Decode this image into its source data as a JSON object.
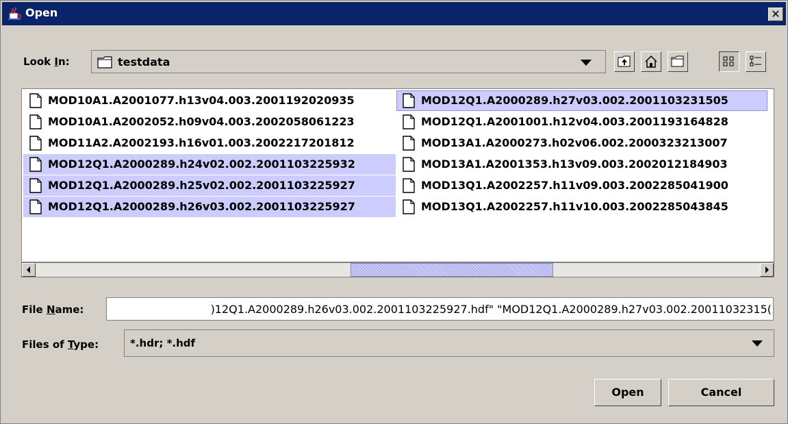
{
  "window": {
    "title": "Open",
    "close_label": "✕"
  },
  "look_in": {
    "label_pre": "Look ",
    "label_key": "I",
    "label_post": "n:",
    "value": "testdata"
  },
  "toolbar": {
    "icons": [
      "up-folder-icon",
      "home-icon",
      "new-folder-icon",
      "list-view-icon",
      "details-view-icon"
    ]
  },
  "files": [
    {
      "name": "MOD10A1.A2001077.h13v04.003.2001192020935",
      "selected": false
    },
    {
      "name": "MOD10A1.A2002052.h09v04.003.2002058061223",
      "selected": false
    },
    {
      "name": "MOD11A2.A2002193.h16v01.003.2002217201812",
      "selected": false
    },
    {
      "name": "MOD12Q1.A2000289.h24v02.002.2001103225932",
      "selected": true
    },
    {
      "name": "MOD12Q1.A2000289.h25v02.002.2001103225927",
      "selected": true
    },
    {
      "name": "MOD12Q1.A2000289.h26v03.002.2001103225927",
      "selected": true
    },
    {
      "name": "MOD12Q1.A2000289.h27v03.002.2001103231505",
      "selected": true
    },
    {
      "name": "MOD12Q1.A2001001.h12v04.003.2001193164828",
      "selected": false
    },
    {
      "name": "MOD13A1.A2000273.h02v06.002.2000323213007",
      "selected": false
    },
    {
      "name": "MOD13A1.A2001353.h13v09.003.2002012184903",
      "selected": false
    },
    {
      "name": "MOD13Q1.A2002257.h11v09.003.2002285041900",
      "selected": false
    },
    {
      "name": "MOD13Q1.A2002257.h11v10.003.2002285043845",
      "selected": false
    }
  ],
  "file_name": {
    "label_pre": "File ",
    "label_key": "N",
    "label_post": "ame:",
    "value": ")12Q1.A2000289.h26v03.002.2001103225927.hdf\" \"MOD12Q1.A2000289.h27v03.002.20011032315("
  },
  "files_of_type": {
    "label_pre": "Files of ",
    "label_key": "T",
    "label_post": "ype:",
    "value": "*.hdr; *.hdf"
  },
  "buttons": {
    "open": "Open",
    "cancel": "Cancel"
  },
  "colors": {
    "title_bar": "#0a246a",
    "selection": "#ccccff",
    "background": "#d4d0c8"
  }
}
